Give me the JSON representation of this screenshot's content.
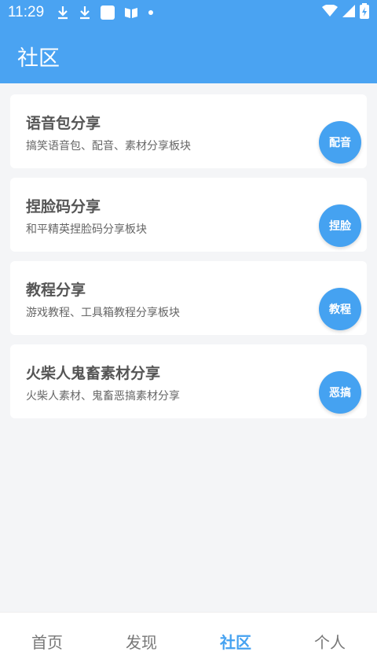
{
  "status": {
    "time": "11:29",
    "icons": [
      "download-icon",
      "download-icon",
      "square-app-icon",
      "book-icon",
      "dot-icon",
      "wifi-icon",
      "signal-icon",
      "battery-icon"
    ]
  },
  "header": {
    "title": "社区"
  },
  "cards": [
    {
      "title": "语音包分享",
      "desc": "搞笑语音包、配音、素材分享板块",
      "btn": "配音"
    },
    {
      "title": "捏脸码分享",
      "desc": "和平精英捏脸码分享板块",
      "btn": "捏脸"
    },
    {
      "title": "教程分享",
      "desc": "游戏教程、工具箱教程分享板块",
      "btn": "教程"
    },
    {
      "title": "火柴人鬼畜素材分享",
      "desc": "火柴人素材、鬼畜恶搞素材分享",
      "btn": "恶搞"
    }
  ],
  "tabs": [
    {
      "label": "首页"
    },
    {
      "label": "发现"
    },
    {
      "label": "社区",
      "active": true
    },
    {
      "label": "个人"
    }
  ],
  "colors": {
    "accent": "#4aa3f2",
    "background": "#f4f5f7"
  }
}
